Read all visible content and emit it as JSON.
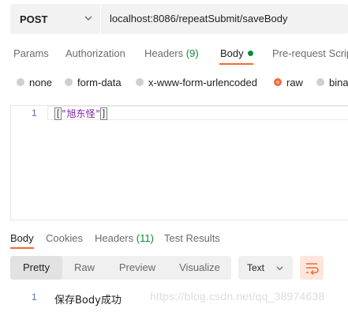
{
  "request": {
    "method": "POST",
    "url": "localhost:8086/repeatSubmit/saveBody"
  },
  "request_tabs": {
    "params": "Params",
    "authorization": "Authorization",
    "headers": "Headers",
    "headers_count": "(9)",
    "body": "Body",
    "pre_request": "Pre-request Scrip"
  },
  "body_types": {
    "none": "none",
    "form_data": "form-data",
    "urlencoded": "x-www-form-urlencoded",
    "raw": "raw",
    "binary": "bina",
    "selected": "raw"
  },
  "editor": {
    "line_number": "1",
    "open": "[",
    "content": "\"旭东怪\"",
    "close": "]"
  },
  "response_tabs": {
    "body": "Body",
    "cookies": "Cookies",
    "headers": "Headers",
    "headers_count": "(11)",
    "test_results": "Test Results"
  },
  "view_modes": {
    "pretty": "Pretty",
    "raw": "Raw",
    "preview": "Preview",
    "visualize": "Visualize",
    "selected": "Pretty"
  },
  "format": {
    "value": "Text"
  },
  "response": {
    "line_number": "1",
    "text": "保存Body成功"
  },
  "watermark": "https://blog.csdn.net/qq_38974638",
  "colors": {
    "accent": "#ef6c32",
    "count_green": "#0c8a38"
  }
}
